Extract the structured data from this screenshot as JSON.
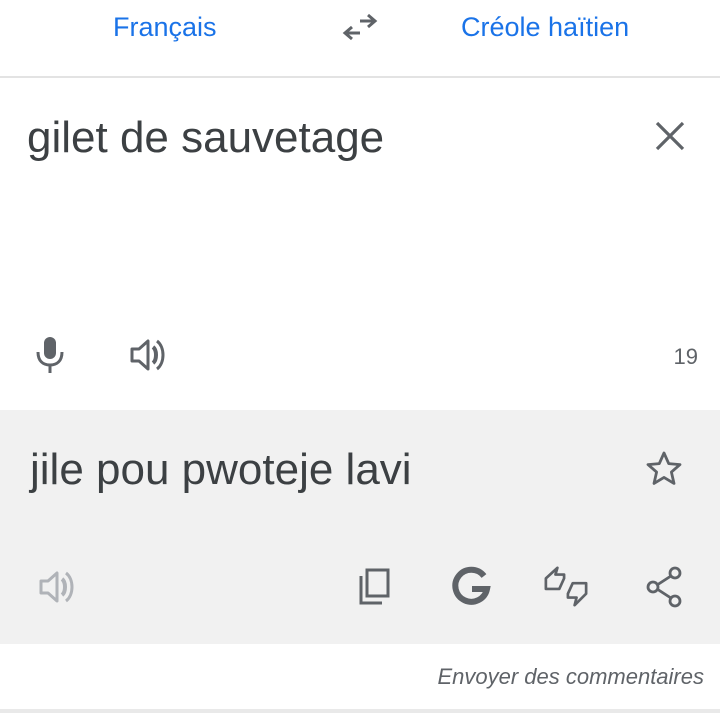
{
  "languages": {
    "source": "Français",
    "target": "Créole haïtien"
  },
  "icons": {
    "swap": "swap-arrows-icon",
    "clear": "close-icon",
    "mic": "microphone-icon",
    "speak": "speaker-icon",
    "star": "star-icon",
    "copy": "copy-icon",
    "google": "google-g-icon",
    "rate": "thumbs-up-down-icon",
    "share": "share-icon"
  },
  "source": {
    "text": "gilet de sauvetage",
    "char_count": "19"
  },
  "result": {
    "text": "jile pou pwoteje lavi"
  },
  "footer": {
    "feedback_label": "Envoyer des commentaires"
  },
  "colors": {
    "accent": "#1a73e8",
    "text": "#3c4043",
    "icon": "#5f6368",
    "result_bg": "#f1f1f1"
  }
}
